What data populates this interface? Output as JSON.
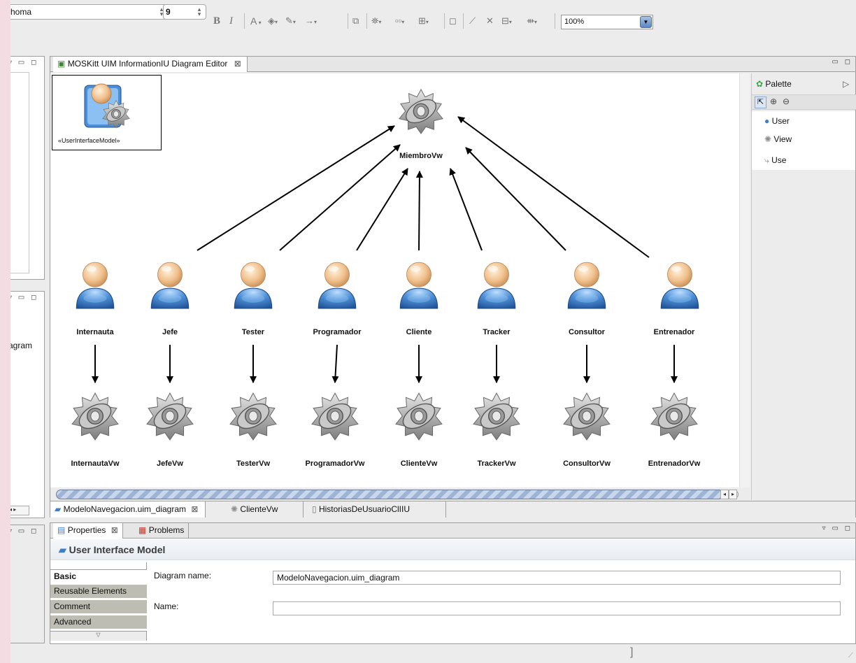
{
  "toolbar": {
    "font_name": "homa",
    "font_size": "9",
    "bold": "B",
    "italic": "I",
    "font_color": "A",
    "zoom": "100%"
  },
  "left_views": {
    "middle_text": "agram"
  },
  "editor": {
    "tab_title": "MOSKitt UIM InformationIU Diagram Editor",
    "model_label": "«UserInterfaceModel»",
    "central_view": "MiembroVw",
    "users": [
      "Internauta",
      "Jefe",
      "Tester",
      "Programador",
      "Cliente",
      "Tracker",
      "Consultor",
      "Entrenador"
    ],
    "views": [
      "InternautaVw",
      "JefeVw",
      "TesterVw",
      "ProgramadorVw",
      "ClienteVw",
      "TrackerVw",
      "ConsultorVw",
      "EntrenadorVw"
    ],
    "bottom_tabs": [
      "ModeloNavegacion.uim_diagram",
      "ClienteVw",
      "HistoriasDeUsuarioClIIU"
    ]
  },
  "palette": {
    "title": "Palette",
    "items": [
      "User",
      "View",
      "Use"
    ]
  },
  "properties": {
    "tabs": [
      "Properties",
      "Problems"
    ],
    "title": "User Interface Model",
    "side_tabs": [
      "Basic",
      "Reusable Elements",
      "Comment",
      "Advanced"
    ],
    "diagram_name_label": "Diagram name:",
    "diagram_name_value": "ModeloNavegacion.uim_diagram",
    "name_label": "Name:",
    "name_value": ""
  },
  "colors": {
    "user_head": "#f2c89a",
    "user_body": "#3f7dc6",
    "eye_gray": "#8e8e8e",
    "selection_blue": "#5b86c4"
  }
}
